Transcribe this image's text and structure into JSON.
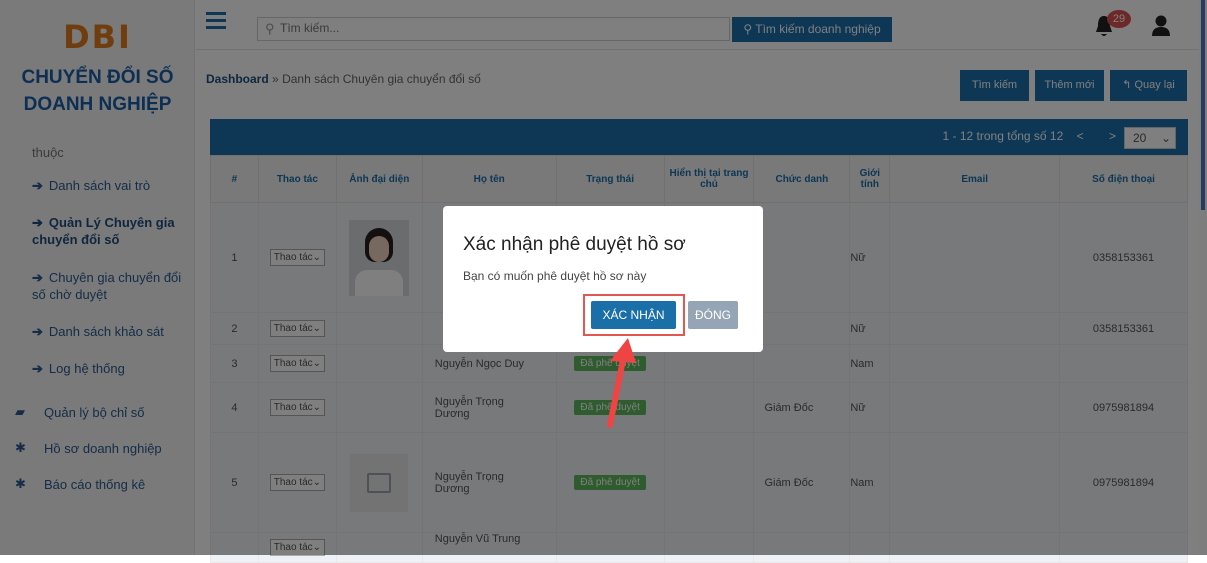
{
  "sidebar": {
    "logo": "DBI",
    "brand_line1": "CHUYỂN ĐỔI SỐ",
    "brand_line2": "DOANH NGHIỆP",
    "items": [
      {
        "label": "thuộc",
        "icon": ""
      },
      {
        "label": "Danh sách vai trò",
        "icon": "arrow-right-icon"
      },
      {
        "label": "Quản Lý Chuyên gia chuyển đổi số",
        "icon": "arrow-right-icon"
      },
      {
        "label": "Chuyên gia chuyển đổi số chờ duyệt",
        "icon": "arrow-right-icon"
      },
      {
        "label": "Danh sách khảo sát",
        "icon": "arrow-right-icon"
      },
      {
        "label": "Log hệ thống",
        "icon": "arrow-right-icon"
      },
      {
        "label": "Quản lý bộ chỉ số",
        "icon": "book-icon"
      },
      {
        "label": "Hồ sơ doanh nghiệp",
        "icon": "asterisk-icon"
      },
      {
        "label": "Báo cáo thống kê",
        "icon": "asterisk-icon"
      }
    ]
  },
  "topbar": {
    "search_placeholder": "Tìm kiếm...",
    "search_business_label": "Tìm kiếm doanh nghiệp",
    "notification_count": "29"
  },
  "breadcrumb": {
    "root": "Dashboard",
    "separator": "»",
    "current": "Danh sách Chuyên gia chuyển đổi số"
  },
  "toolbar": {
    "search_label": "Tìm kiếm",
    "add_label": "Thêm mới",
    "back_label": "Quay lại"
  },
  "table": {
    "pagination": "1 - 12 trong tổng số 12",
    "page_size": "20",
    "headers": [
      "#",
      "Thao tác",
      "Ảnh đại diện",
      "Họ tên",
      "Trạng thái",
      "Hiển thị tại trang chủ",
      "Chức danh",
      "Giới tính",
      "Email",
      "Số điện thoại"
    ],
    "action_label": "Thao tác",
    "rows": [
      {
        "no": "1",
        "name": "",
        "status": "",
        "title": "",
        "gender": "Nữ",
        "phone": "0358153361"
      },
      {
        "no": "2",
        "name": "",
        "status": "",
        "title": "",
        "gender": "Nữ",
        "phone": "0358153361"
      },
      {
        "no": "3",
        "name": "Nguyễn Ngọc Duy",
        "status": "Đã phê duyệt",
        "title": "",
        "gender": "Nam",
        "phone": ""
      },
      {
        "no": "4",
        "name": "Nguyễn Trọng Dương",
        "status": "Đã phê duyệt",
        "title": "Giám Đốc",
        "gender": "Nữ",
        "phone": "0975981894"
      },
      {
        "no": "5",
        "name": "Nguyễn Trọng Dương",
        "status": "Đã phê duyệt",
        "title": "Giám Đốc",
        "gender": "Nam",
        "phone": "0975981894"
      },
      {
        "no": "",
        "name": "Nguyễn Vũ Trung",
        "status": "",
        "title": "",
        "gender": "",
        "phone": ""
      }
    ]
  },
  "modal": {
    "title": "Xác nhận phê duyệt hồ sơ",
    "message": "Bạn có muốn phê duyệt hồ sơ này",
    "confirm_label": "XÁC NHẬN",
    "close_label": "ĐÓNG"
  }
}
